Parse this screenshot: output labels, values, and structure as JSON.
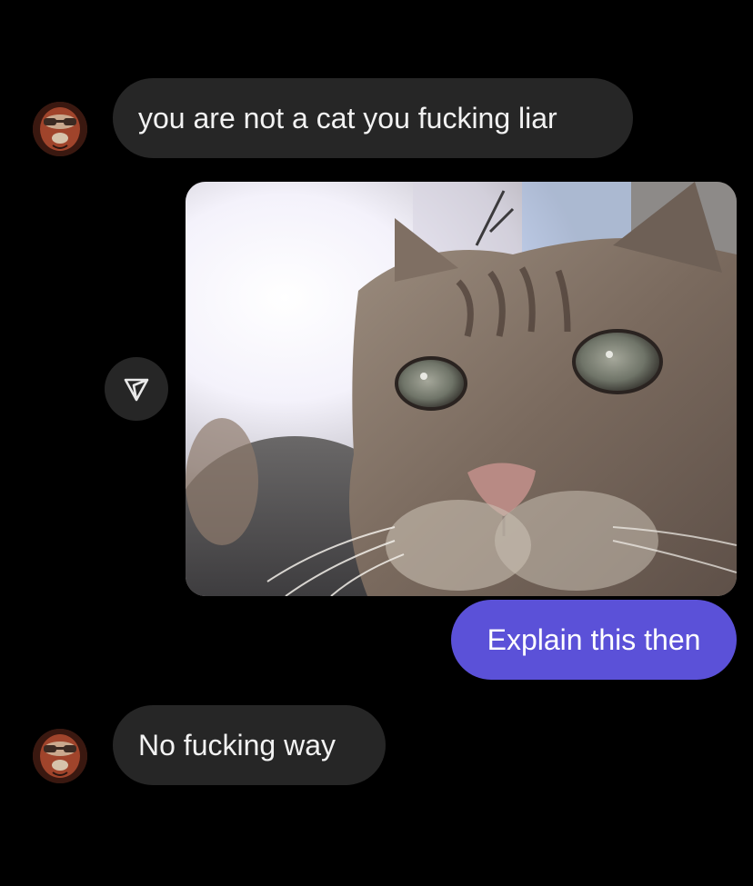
{
  "messages": [
    {
      "sender": "other",
      "text": "you are not a cat you fucking liar"
    },
    {
      "sender": "me",
      "type": "photo",
      "subject": "close-up of a tabby cat"
    },
    {
      "sender": "me",
      "text": "Explain this then"
    },
    {
      "sender": "other",
      "text": "No fucking way"
    }
  ],
  "icons": {
    "share": "send-arrow-icon",
    "avatar": "avatar"
  },
  "colors": {
    "background": "#000000",
    "incoming_bubble": "#262626",
    "outgoing_bubble": "#5b51d8",
    "text": "#f2f2f2"
  }
}
